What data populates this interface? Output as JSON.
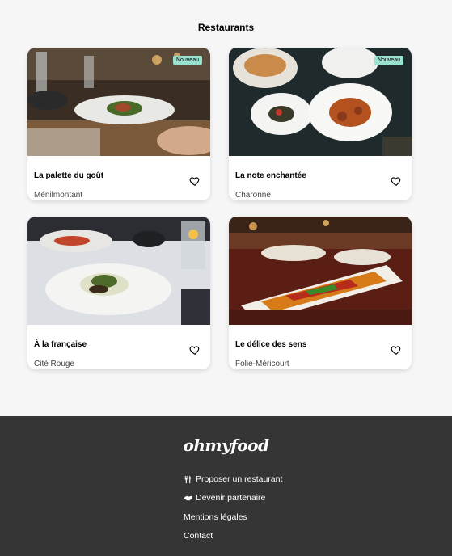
{
  "section": {
    "title": "Restaurants"
  },
  "cards": [
    {
      "name": "La palette du goût",
      "location": "Ménilmontant",
      "badge": "Nouveau"
    },
    {
      "name": "La note enchantée",
      "location": "Charonne",
      "badge": "Nouveau"
    },
    {
      "name": "À la française",
      "location": "Cité Rouge"
    },
    {
      "name": "Le délice des sens",
      "location": "Folie-Méricourt"
    }
  ],
  "footer": {
    "logo": "ohmyfood",
    "links": [
      {
        "label": "Proposer un restaurant",
        "icon": "utensils-icon"
      },
      {
        "label": "Devenir partenaire",
        "icon": "handshake-icon"
      },
      {
        "label": "Mentions légales"
      },
      {
        "label": "Contact"
      }
    ]
  },
  "colors": {
    "badge": "#99e2d0",
    "footer": "#353535",
    "page": "#f6f6f6"
  }
}
